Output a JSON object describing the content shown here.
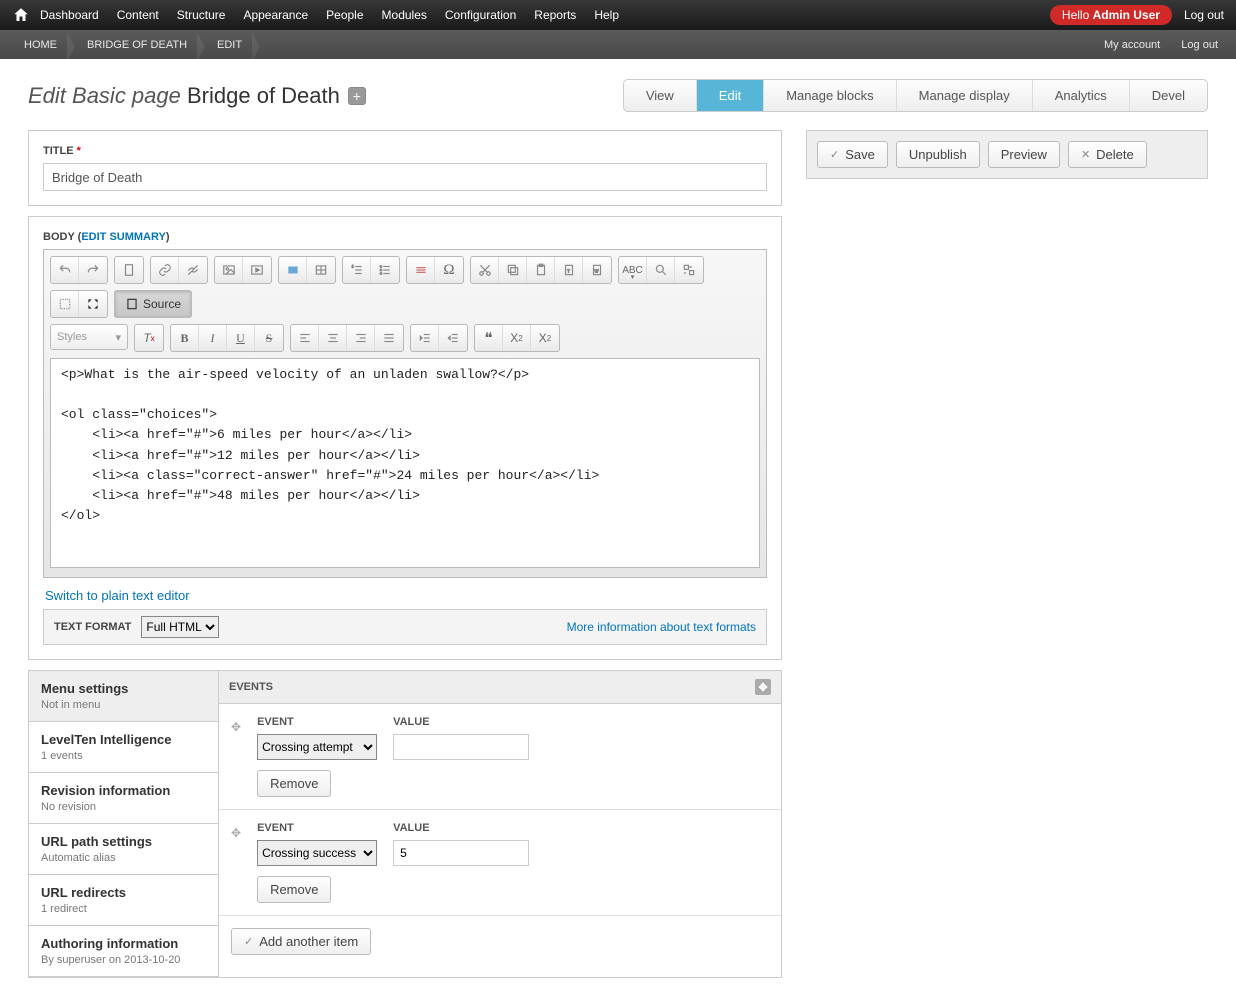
{
  "topmenu": [
    "Dashboard",
    "Content",
    "Structure",
    "Appearance",
    "People",
    "Modules",
    "Configuration",
    "Reports",
    "Help"
  ],
  "hello": {
    "prefix": "Hello ",
    "user": "Admin User"
  },
  "logout": "Log out",
  "submenu": {
    "crumbs": [
      "HOME",
      "BRIDGE OF DEATH",
      "EDIT"
    ],
    "right": [
      "My account",
      "Log out"
    ]
  },
  "page_title": {
    "prefix": "Edit Basic page",
    "name": "Bridge of Death"
  },
  "tabs": [
    "View",
    "Edit",
    "Manage blocks",
    "Manage display",
    "Analytics",
    "Devel"
  ],
  "active_tab": "Edit",
  "title_field": {
    "label": "TITLE",
    "required": true,
    "value": "Bridge of Death"
  },
  "body": {
    "label": "BODY",
    "summary_link": "EDIT SUMMARY",
    "source_label": "Source",
    "styles_label": "Styles",
    "content": "<p>What is the air-speed velocity of an unladen swallow?</p>\n\n<ol class=\"choices\">\n    <li><a href=\"#\">6 miles per hour</a></li>\n    <li><a href=\"#\">12 miles per hour</a></li>\n    <li><a class=\"correct-answer\" href=\"#\">24 miles per hour</a></li>\n    <li><a href=\"#\">48 miles per hour</a></li>\n</ol>"
  },
  "plain_text_link": "Switch to plain text editor",
  "text_format": {
    "label": "TEXT FORMAT",
    "value": "Full HTML",
    "more": "More information about text formats"
  },
  "vtabs": [
    {
      "title": "Menu settings",
      "sub": "Not in menu",
      "active": true
    },
    {
      "title": "LevelTen Intelligence",
      "sub": "1 events"
    },
    {
      "title": "Revision information",
      "sub": "No revision"
    },
    {
      "title": "URL path settings",
      "sub": "Automatic alias"
    },
    {
      "title": "URL redirects",
      "sub": "1 redirect"
    },
    {
      "title": "Authoring information",
      "sub": "By superuser on 2013-10-20"
    }
  ],
  "events": {
    "heading": "EVENTS",
    "cols": {
      "event": "EVENT",
      "value": "VALUE"
    },
    "rows": [
      {
        "event": "Crossing attempt",
        "value": ""
      },
      {
        "event": "Crossing success",
        "value": "5"
      }
    ],
    "remove": "Remove",
    "add": "Add another item"
  },
  "actions": {
    "save": "Save",
    "unpublish": "Unpublish",
    "preview": "Preview",
    "delete": "Delete"
  }
}
